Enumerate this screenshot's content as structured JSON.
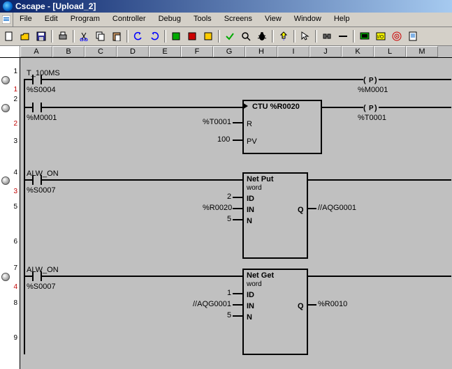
{
  "title": "Cscape - [Upload_2]",
  "menu": {
    "file": "File",
    "edit": "Edit",
    "program": "Program",
    "controller": "Controller",
    "debug": "Debug",
    "tools": "Tools",
    "screens": "Screens",
    "view": "View",
    "window": "Window",
    "help": "Help"
  },
  "toolbar_icons": {
    "new": "new",
    "open": "open",
    "save": "save",
    "print": "print",
    "cut": "cut",
    "copy": "copy",
    "paste": "paste",
    "undo": "undo",
    "redo": "redo",
    "run": "run",
    "stop": "stop",
    "idle": "idle",
    "check": "check",
    "find": "find",
    "bug": "bug",
    "help": "help",
    "arrow": "arrow",
    "conn": "conn",
    "wire": "wire",
    "screen": "screen",
    "io": "io",
    "target": "target",
    "sheet": "sheet"
  },
  "columns": [
    "A",
    "B",
    "C",
    "D",
    "E",
    "F",
    "G",
    "H",
    "I",
    "J",
    "K",
    "L",
    "M"
  ],
  "rows": {
    "r1": "1",
    "r1r": "1",
    "r2": "2",
    "r2r": "2",
    "r3": "3",
    "r4": "4",
    "r3r": "3",
    "r5": "5",
    "r6": "6",
    "r7": "7",
    "r4r": "4",
    "r8": "8",
    "r9": "9"
  },
  "rung1": {
    "contact": "T_100MS",
    "contact_addr": "%S0004",
    "coil_sym": "(P)",
    "coil_addr": "%M0001"
  },
  "rung2": {
    "contact": "%M0001",
    "block_title": "CTU   %R0020",
    "p_r_label": "R",
    "p_r_value": "%T0001",
    "p_pv_label": "PV",
    "p_pv_value": "100",
    "coil_sym": "(P)",
    "coil_addr": "%T0001"
  },
  "rung3": {
    "contact": "ALW_ON",
    "contact_addr": "%S0007",
    "block_title": "Net Put",
    "block_sub": "word",
    "p_id_label": "ID",
    "p_id_value": "2",
    "p_in_label": "IN",
    "p_in_value": "%R0020",
    "p_n_label": "N",
    "p_n_value": "5",
    "p_q_label": "Q",
    "p_q_value": "//AQG0001"
  },
  "rung4": {
    "contact": "ALW_ON",
    "contact_addr": "%S0007",
    "block_title": "Net Get",
    "block_sub": "word",
    "p_id_label": "ID",
    "p_id_value": "1",
    "p_in_label": "IN",
    "p_in_value": "//AQG0001",
    "p_n_label": "N",
    "p_n_value": "5",
    "p_q_label": "Q",
    "p_q_value": "%R0010"
  }
}
